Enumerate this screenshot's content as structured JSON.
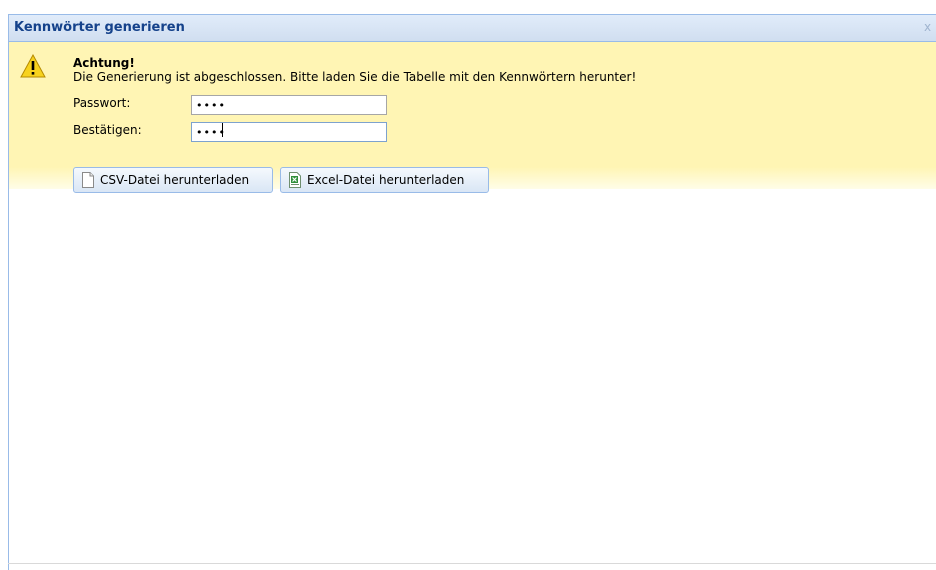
{
  "window": {
    "title": "Kennwörter generieren",
    "close_label": "x"
  },
  "alert": {
    "icon": "warning-icon",
    "title": "Achtung!",
    "message": "Die Generierung ist abgeschlossen. Bitte laden Sie die Tabelle mit den Kennwörtern herunter!"
  },
  "form": {
    "password_label": "Passwort:",
    "password_value": "••••",
    "confirm_label": "Bestätigen:",
    "confirm_value": "••••"
  },
  "buttons": {
    "csv_label": "CSV-Datei herunterladen",
    "csv_icon": "document-icon",
    "excel_label": "Excel-Datei herunterladen",
    "excel_icon": "excel-file-icon"
  },
  "colors": {
    "alert_background": "#fff5b4",
    "title_text": "#15428b",
    "button_border": "#99bbe8"
  }
}
